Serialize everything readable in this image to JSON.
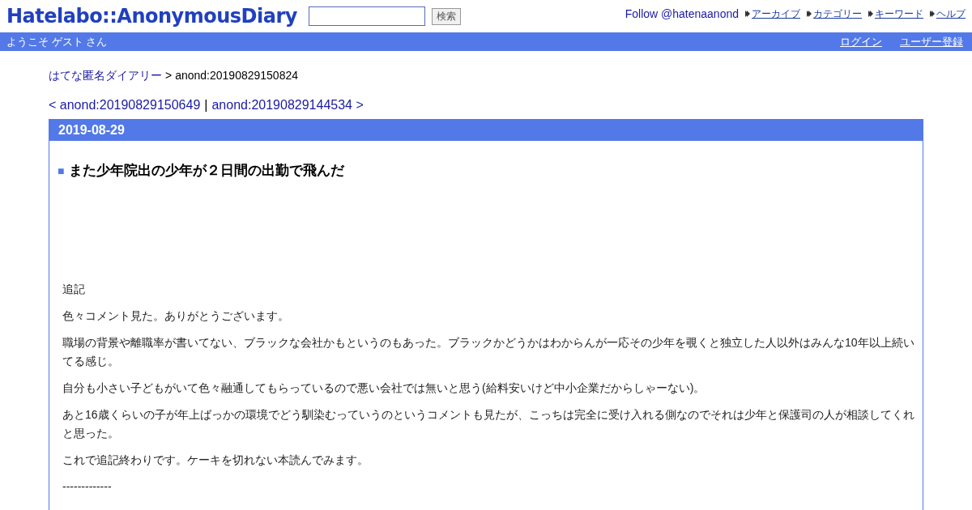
{
  "header": {
    "logo": "Hatelabo::AnonymousDiary",
    "search": {
      "button": "検索"
    },
    "follow": "Follow @hatenaanond",
    "links": [
      "アーカイブ",
      "カテゴリー",
      "キーワード",
      "ヘルプ"
    ]
  },
  "user_bar": {
    "greeting": "ようこそ ゲスト さん",
    "links": [
      "ログイン",
      "ユーザー登録"
    ]
  },
  "breadcrumb": {
    "home": "はてな匿名ダイアリー",
    "separator": ">",
    "current": "anond:20190829150824"
  },
  "pager": {
    "prev": "< anond:20190829150649",
    "separator": "|",
    "next": "anond:20190829144534 >"
  },
  "entry": {
    "date": "2019-08-29",
    "title_mark": "■",
    "title": "また少年院出の少年が２日間の出勤で飛んだ",
    "paragraphs": [
      "追記",
      "色々コメント見た。ありがとうございます。",
      "職場の背景や離職率が書いてない、ブラックな会社かもというのもあった。ブラックかどうかはわからんが一応その少年を覗くと独立した人以外はみんな10年以上続いてる感じ。",
      "自分も小さい子どもがいて色々融通してもらっているので悪い会社では無いと思う(給料安いけど中小企業だからしゃーない)。",
      "あと16歳くらいの子が年上ばっかの環境でどう馴染むっていうのというコメントも見たが、こっちは完全に受け入れる側なのでそれは少年と保護司の人が相談してくれと思った。",
      "これで追記終わりです。ケーキを切れない本読んでみます。",
      "-------------"
    ]
  }
}
